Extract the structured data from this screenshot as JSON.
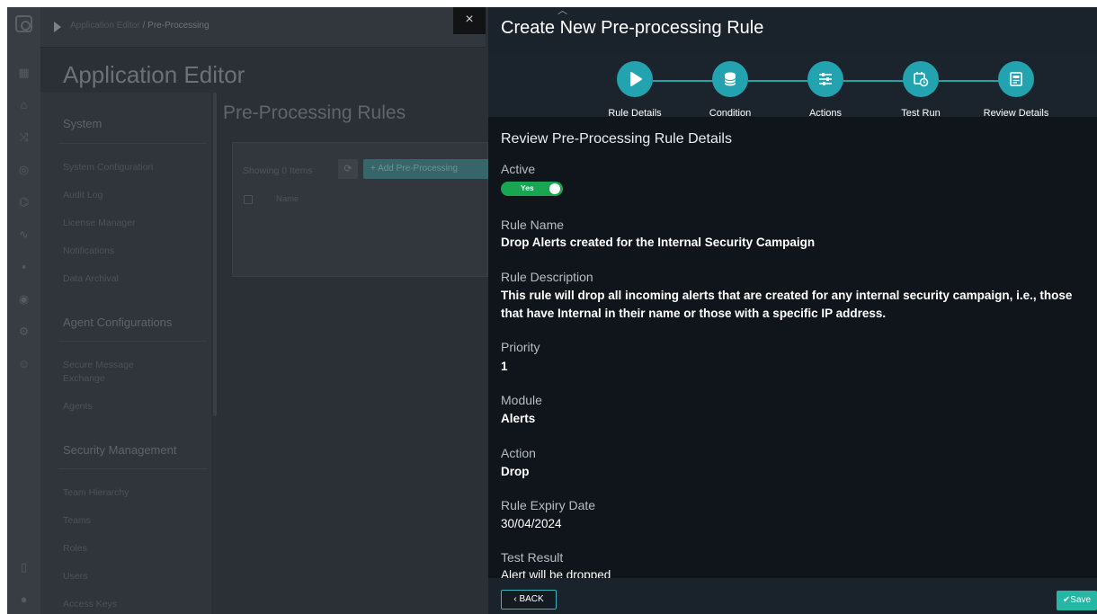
{
  "background": {
    "breadcrumb_app": "Application Editor",
    "breadcrumb_sep": "/",
    "breadcrumb_page": "Pre-Processing",
    "app_title": "Application Editor",
    "sidebar": {
      "system_header": "System",
      "system_items": [
        "System Configuration",
        "Audit Log",
        "License Manager",
        "Notifications",
        "Data Archival"
      ],
      "agent_header": "Agent Configurations",
      "agent_items": [
        "Secure Message Exchange",
        "Agents"
      ],
      "security_header": "Security Management",
      "security_items": [
        "Team Hierarchy",
        "Teams",
        "Roles",
        "Users",
        "Access Keys"
      ]
    },
    "page_title": "Pre-Processing Rules",
    "showing_text": "Showing 0 Items",
    "add_button": "+ Add Pre-Processing",
    "column_name": "Name"
  },
  "panel": {
    "title": "Create New Pre-processing Rule",
    "close_glyph": "×",
    "steps": [
      {
        "label": "Rule Details",
        "icon": "play-icon"
      },
      {
        "label": "Condition",
        "icon": "database-icon"
      },
      {
        "label": "Actions",
        "icon": "sliders-icon"
      },
      {
        "label": "Test Run",
        "icon": "calendar-clock-icon"
      },
      {
        "label": "Review Details",
        "icon": "document-icon"
      }
    ],
    "review_title": "Review Pre-Processing Rule Details",
    "active_label": "Active",
    "active_value": "Yes",
    "rule_name_label": "Rule Name",
    "rule_name_value": "Drop Alerts created for the Internal Security Campaign",
    "rule_desc_label": "Rule Description",
    "rule_desc_value": "This rule will drop all incoming alerts that are created for any internal security campaign, i.e., those that have Internal in their name or those with a specific IP address.",
    "priority_label": "Priority",
    "priority_value": "1",
    "module_label": "Module",
    "module_value": "Alerts",
    "action_label": "Action",
    "action_value": "Drop",
    "expiry_label": "Rule Expiry Date",
    "expiry_value": "30/04/2024",
    "test_result_label": "Test Result",
    "test_result_value": "Alert will be dropped",
    "back_label": "BACK",
    "save_label": "Save"
  },
  "colors": {
    "accent": "#23a3b0",
    "toggle_on": "#1aa551",
    "panel_bg": "#0f151b",
    "save": "#26b6a4"
  }
}
